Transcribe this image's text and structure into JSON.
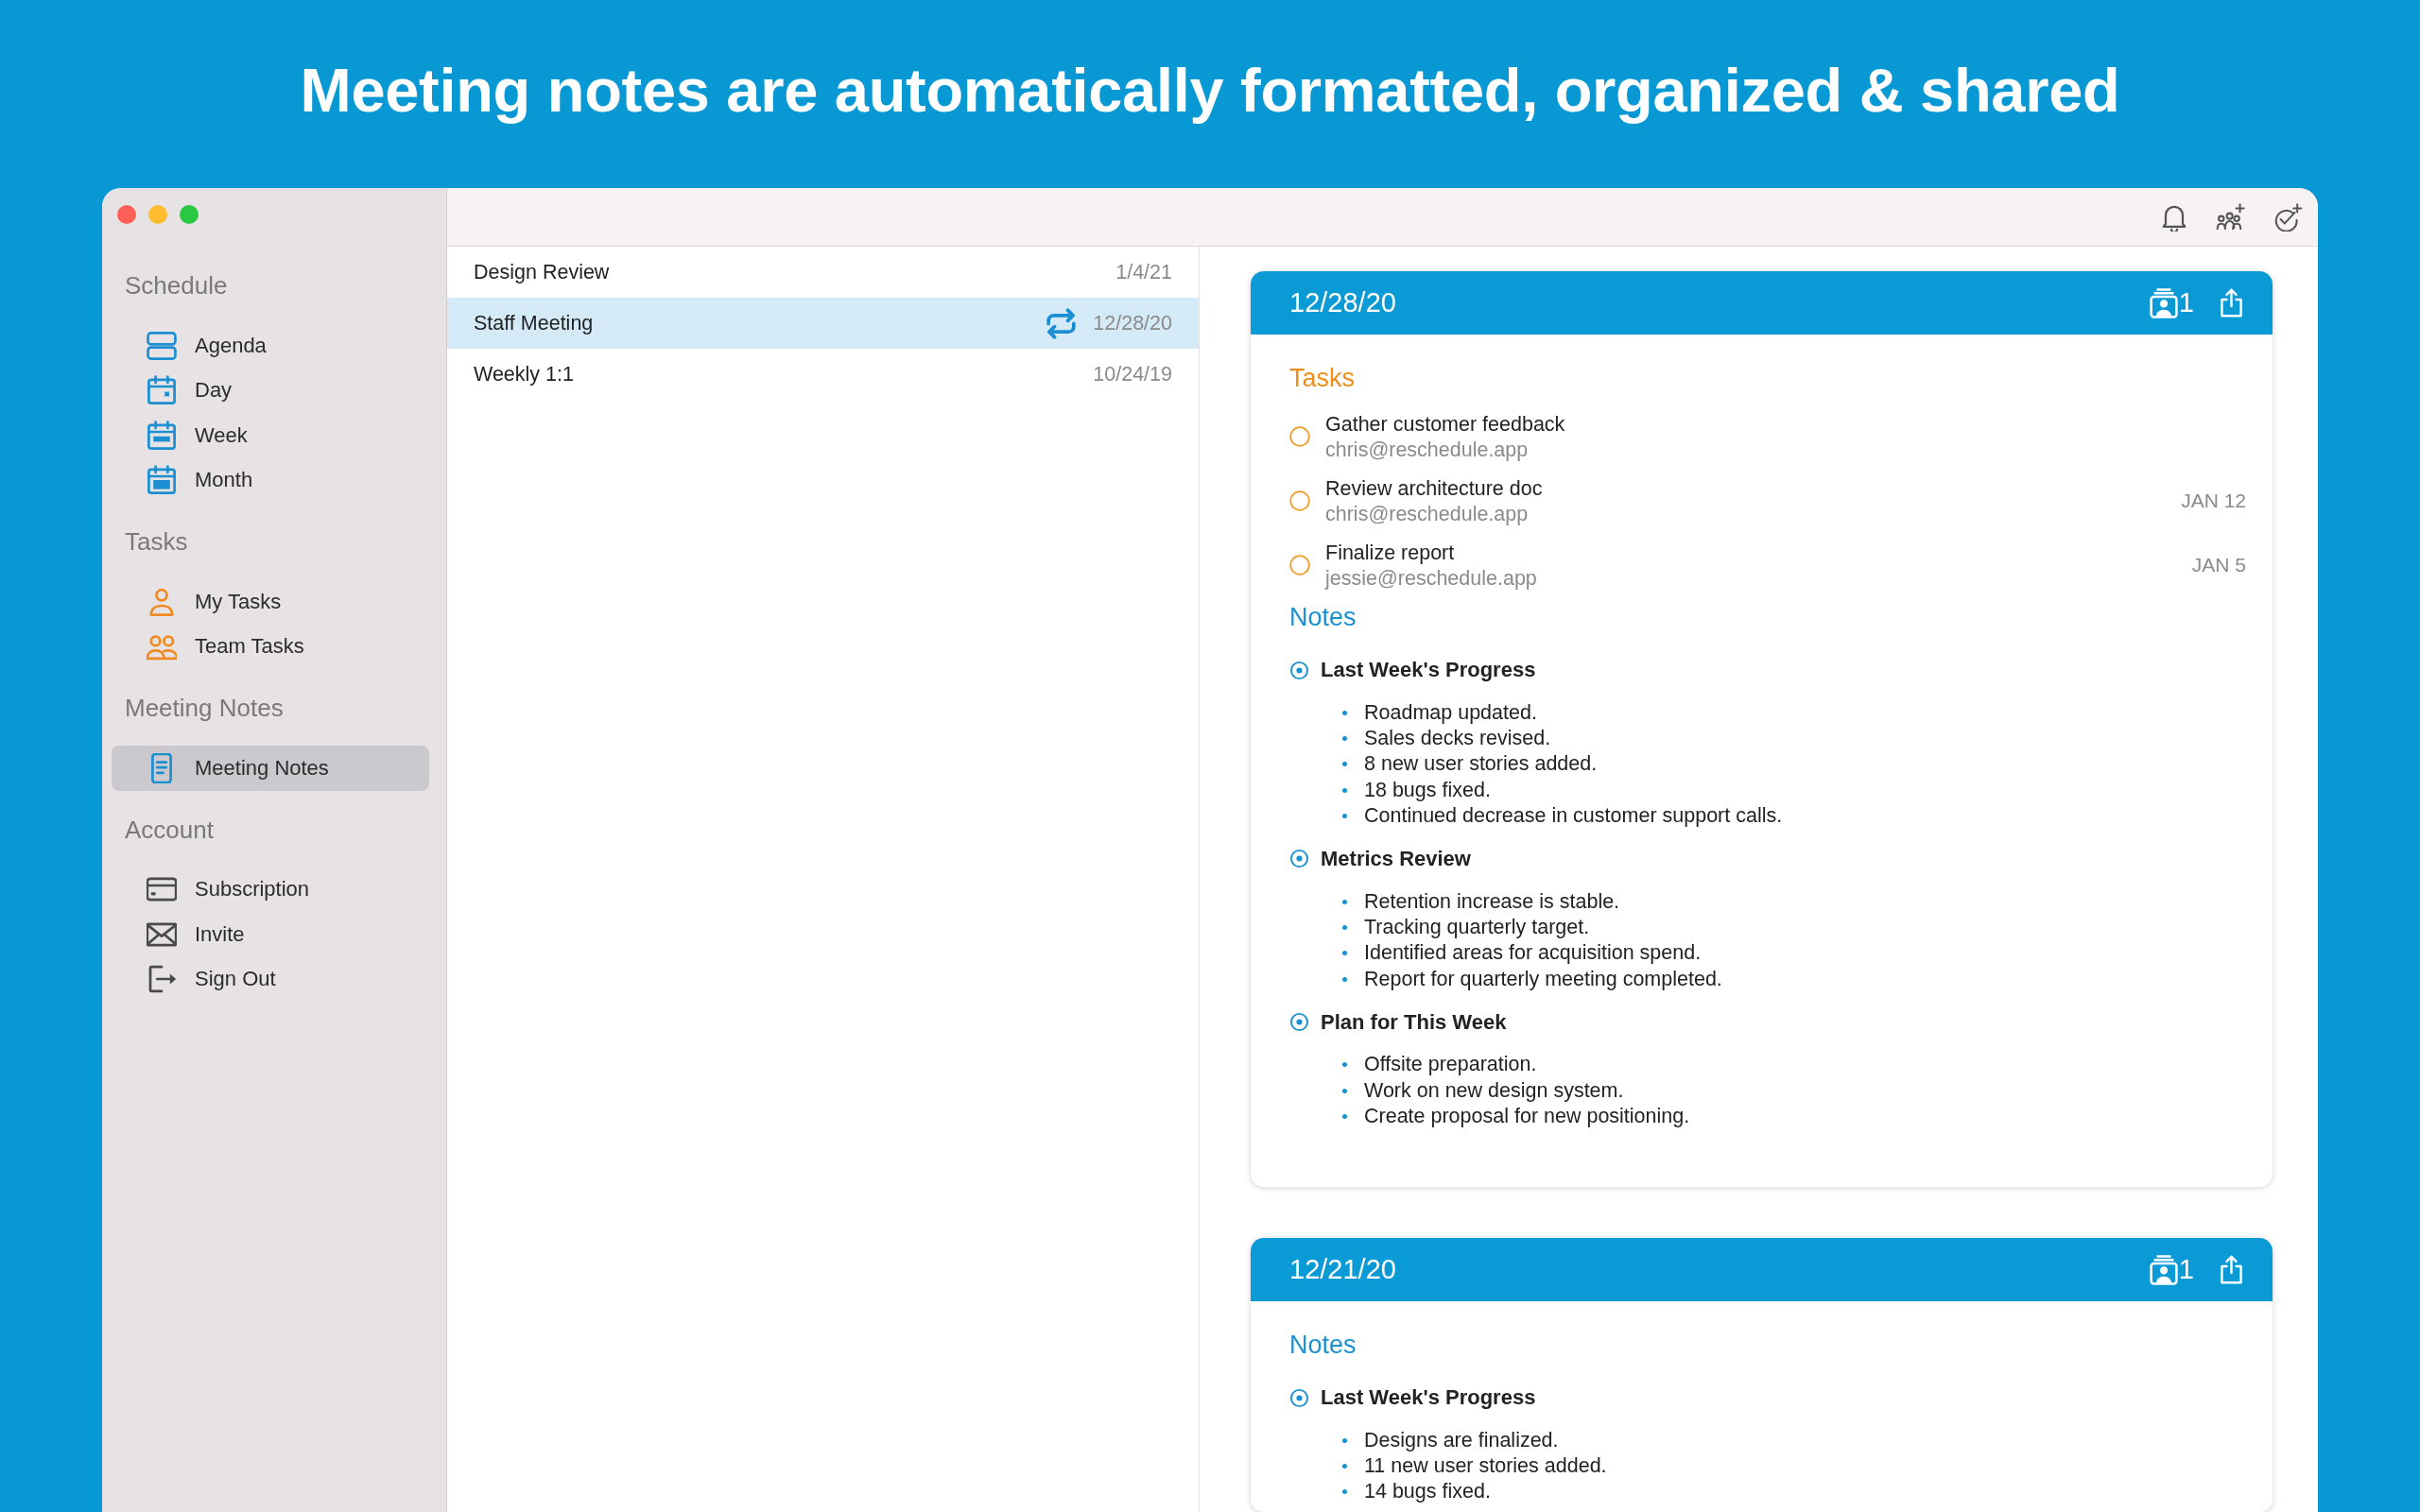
{
  "headline": "Meeting notes are automatically formatted, organized & shared",
  "sidebar": {
    "sections": [
      {
        "title": "Schedule",
        "items": [
          {
            "label": "Agenda",
            "kind": "agenda",
            "selected": false
          },
          {
            "label": "Day",
            "kind": "day",
            "selected": false
          },
          {
            "label": "Week",
            "kind": "week",
            "selected": false
          },
          {
            "label": "Month",
            "kind": "month",
            "selected": false
          }
        ]
      },
      {
        "title": "Tasks",
        "items": [
          {
            "label": "My Tasks",
            "kind": "mine",
            "selected": false
          },
          {
            "label": "Team Tasks",
            "kind": "team",
            "selected": false
          }
        ]
      },
      {
        "title": "Meeting Notes",
        "items": [
          {
            "label": "Meeting Notes",
            "kind": "notes",
            "selected": true
          }
        ]
      },
      {
        "title": "Account",
        "items": [
          {
            "label": "Subscription",
            "kind": "billing",
            "selected": false
          },
          {
            "label": "Invite",
            "kind": "invite",
            "selected": false
          },
          {
            "label": "Sign Out",
            "kind": "signout",
            "selected": false
          }
        ]
      }
    ]
  },
  "meetings": [
    {
      "title": "Design Review",
      "date": "1/4/21",
      "recurring": false,
      "selected": false
    },
    {
      "title": "Staff Meeting",
      "date": "12/28/20",
      "recurring": true,
      "selected": true
    },
    {
      "title": "Weekly 1:1",
      "date": "10/24/19",
      "recurring": false,
      "selected": false
    }
  ],
  "entries": [
    {
      "date": "12/28/20",
      "attendees": "1",
      "tasks": {
        "title": "Tasks",
        "items": [
          {
            "title": "Gather customer feedback",
            "assignee": "chris@reschedule.app",
            "checked": false
          },
          {
            "title": "Review architecture doc",
            "assignee": "chris@reschedule.app",
            "due": "JAN 12",
            "checked": false
          },
          {
            "title": "Finalize report",
            "assignee": "jessie@reschedule.app",
            "due": "JAN 5",
            "checked": false
          }
        ]
      },
      "notes": {
        "title": "Notes",
        "sections": [
          {
            "heading": "Last Week's Progress",
            "bullets": [
              "Roadmap updated.",
              "Sales decks revised.",
              "8 new user stories added.",
              "18 bugs fixed.",
              "Continued decrease in customer support calls."
            ]
          },
          {
            "heading": "Metrics Review",
            "bullets": [
              "Retention increase is stable.",
              "Tracking quarterly target.",
              "Identified areas for acquisition spend.",
              "Report for quarterly meeting completed."
            ]
          },
          {
            "heading": "Plan for This Week",
            "bullets": [
              "Offsite preparation.",
              "Work on new design system.",
              "Create proposal for new positioning."
            ]
          }
        ]
      }
    },
    {
      "date": "12/21/20",
      "attendees": "1",
      "notes": {
        "title": "Notes",
        "sections": [
          {
            "heading": "Last Week's Progress",
            "bullets": [
              "Designs are finalized.",
              "11 new user stories added.",
              "14 bugs fixed."
            ]
          }
        ]
      }
    }
  ]
}
